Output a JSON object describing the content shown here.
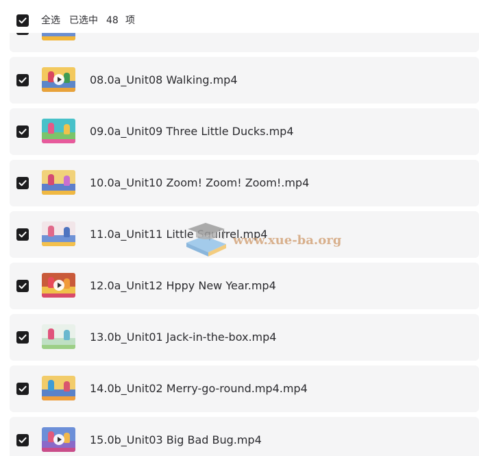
{
  "header": {
    "select_all_label": "全选",
    "selected_prefix": "已选中",
    "selected_count": "48",
    "selected_suffix": "项",
    "select_all_checked": true
  },
  "files": [
    {
      "name": "",
      "checked": true
    },
    {
      "name": "08.0a_Unit08 Walking.mp4",
      "checked": true
    },
    {
      "name": "09.0a_Unit09 Three Little Ducks.mp4",
      "checked": true
    },
    {
      "name": "10.0a_Unit10 Zoom! Zoom! Zoom!.mp4",
      "checked": true
    },
    {
      "name": "11.0a_Unit11 Little Squirrel.mp4",
      "checked": true
    },
    {
      "name": "12.0a_Unit12 Hppy New Year.mp4",
      "checked": true
    },
    {
      "name": "13.0b_Unit01 Jack-in-the-box.mp4",
      "checked": true
    },
    {
      "name": "14.0b_Unit02 Merry-go-round.mp4.mp4",
      "checked": true
    },
    {
      "name": "15.0b_Unit03 Big Bad Bug.mp4",
      "checked": true
    }
  ],
  "thumbnail_icons": [
    "video-thumbnail",
    "play-icon"
  ],
  "watermark": {
    "text": "www.xue-ba.org",
    "icon": "graduation-cap-book-icon"
  },
  "colors": {
    "row_background": "#f5f5f6",
    "checkbox_fill": "#1c1c1e",
    "text": "#2a2a2e",
    "watermark_text": "#cd9664"
  }
}
